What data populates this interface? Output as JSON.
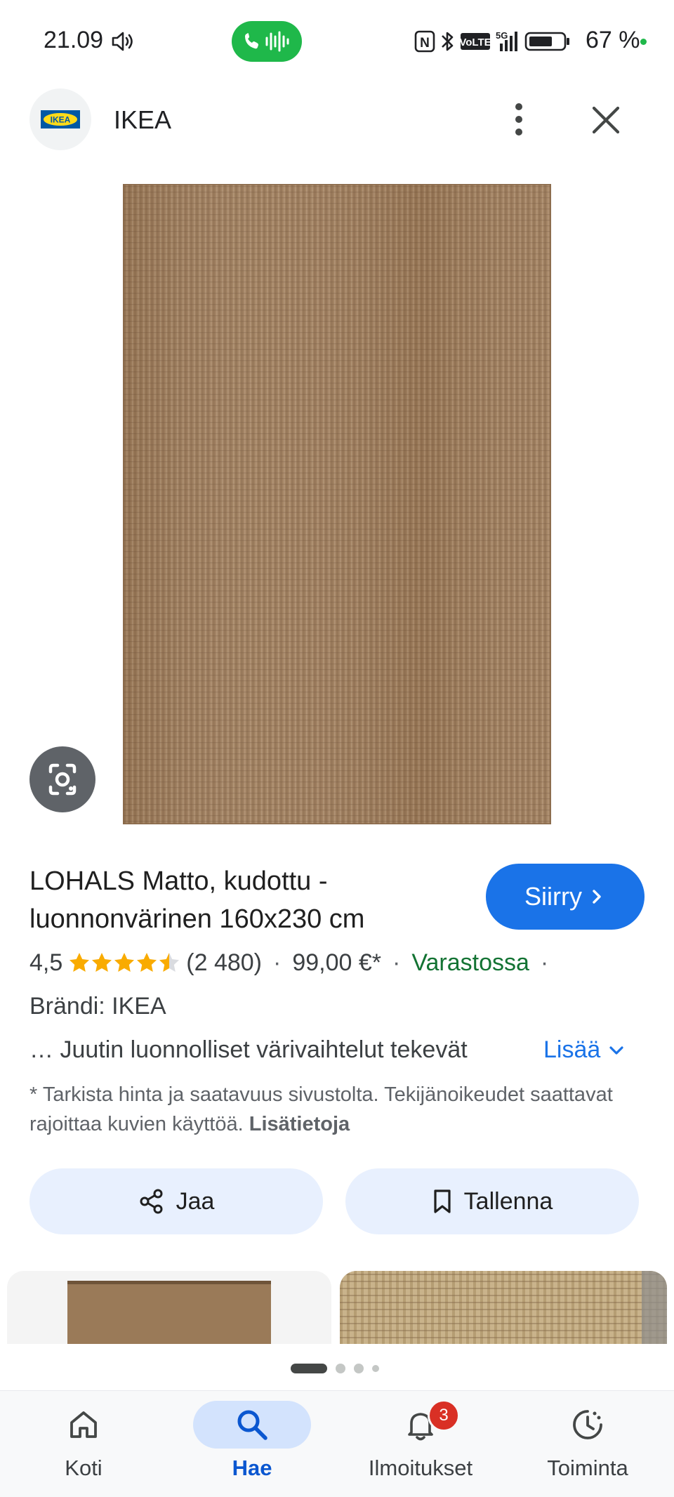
{
  "status_bar": {
    "time": "21.09",
    "battery": "67 %",
    "network_5g": "5G",
    "volte": "VoLTE",
    "nfc": "N"
  },
  "header": {
    "logo_text": "IKEA",
    "site_name": "IKEA"
  },
  "product": {
    "title": "LOHALS Matto, kudottu - luonnonvärinen 160x230 cm",
    "visit_label": "Siirry",
    "rating": "4,5",
    "rating_stars": 4.5,
    "review_count": "(2 480)",
    "price": "99,00 €*",
    "availability": "Varastossa",
    "brand": "Brändi: IKEA",
    "description": "… Juutin luonnolliset värivaihtelut tekevät",
    "more_label": "Lisää",
    "disclaimer": "* Tarkista hinta ja saatavuus sivustolta. Tekijänoikeudet saattavat rajoittaa kuvien käyttöä.",
    "disclaimer_link": "Lisätietoja"
  },
  "actions": {
    "share_label": "Jaa",
    "save_label": "Tallenna"
  },
  "bottom_nav": {
    "home": "Koti",
    "search": "Hae",
    "notifications": "Ilmoitukset",
    "notifications_badge": "3",
    "activity": "Toiminta"
  },
  "colors": {
    "accent": "#1a73e8",
    "stock_green": "#137333",
    "star": "#f9ab00",
    "rug": "#a07f5e",
    "call_pill": "#1fb84a",
    "badge": "#d93025"
  },
  "icons": [
    "sound-icon",
    "call-icon",
    "nfc-icon",
    "bluetooth-icon",
    "signal-icon",
    "battery-icon",
    "more-vert-icon",
    "close-icon",
    "google-lens-icon",
    "star-icon",
    "chevron-right-icon",
    "chevron-down-icon",
    "share-icon",
    "bookmark-icon",
    "home-icon",
    "search-icon",
    "bell-icon",
    "activity-icon"
  ]
}
